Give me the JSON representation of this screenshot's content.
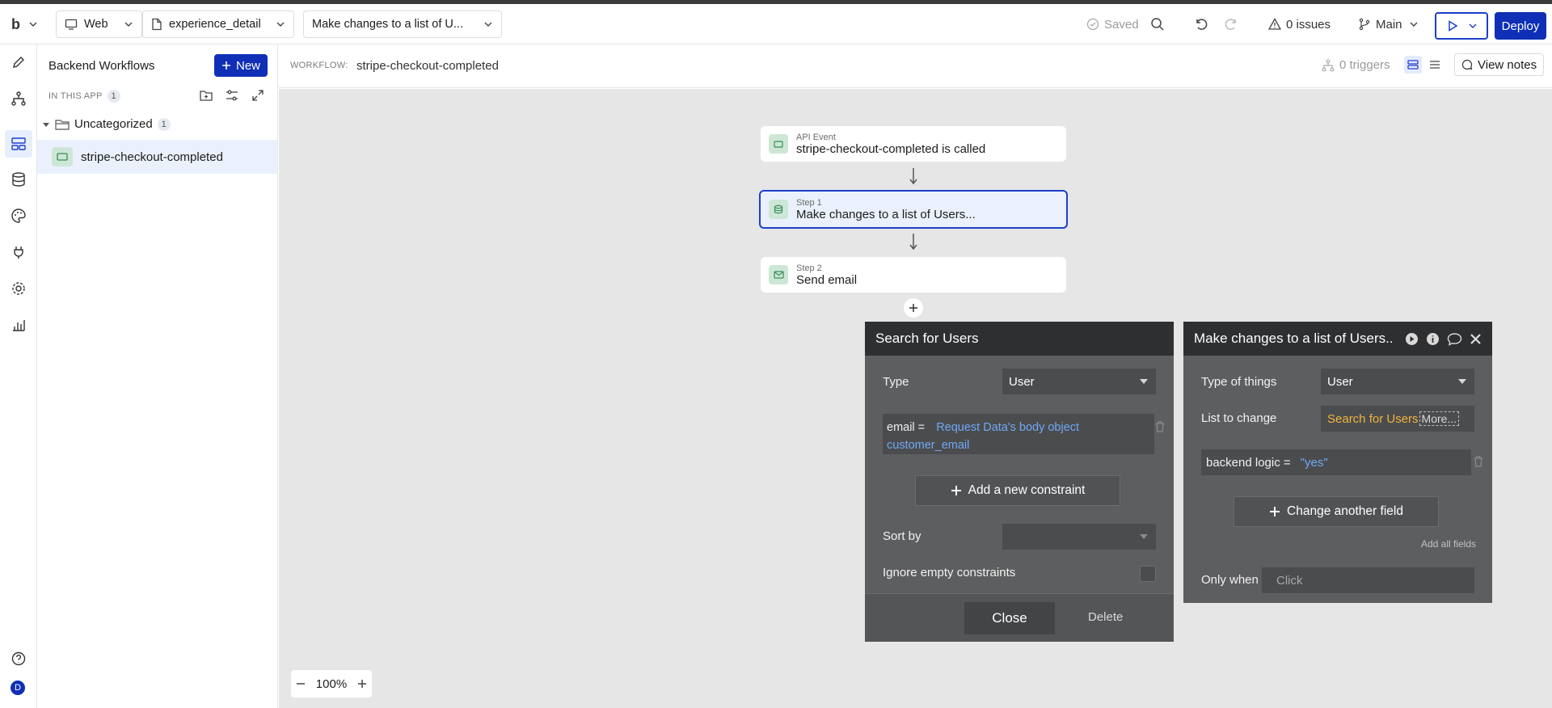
{
  "topbar": {
    "logo": "b",
    "platform": "Web",
    "page": "experience_detail",
    "workflow_select": "Make changes to a list of U...",
    "saved": "Saved",
    "issues": "0 issues",
    "branch": "Main",
    "deploy": "Deploy"
  },
  "sidebar": {
    "title": "Backend Workflows",
    "new_button": "New",
    "in_this_app": "IN THIS APP",
    "in_this_app_count": "1",
    "folder": "Uncategorized",
    "folder_count": "1",
    "workflow_item": "stripe-checkout-completed"
  },
  "rail": {
    "avatar_initial": "D"
  },
  "workflow_bar": {
    "label": "WORKFLOW:",
    "name": "stripe-checkout-completed",
    "triggers": "0 triggers",
    "view_notes": "View notes"
  },
  "canvas": {
    "event": {
      "sub": "API Event",
      "main": "stripe-checkout-completed is called"
    },
    "step1": {
      "sub": "Step 1",
      "main": "Make changes to a list of Users..."
    },
    "step2": {
      "sub": "Step 2",
      "main": "Send email"
    },
    "zoom": "100%"
  },
  "search_panel": {
    "title": "Search for Users",
    "type_label": "Type",
    "type_value": "User",
    "constraint_key": "email =",
    "constraint_value_1": "Request Data's body object",
    "constraint_value_2": "customer_email",
    "add_constraint": "Add a new constraint",
    "sort_by": "Sort by",
    "ignore_empty": "Ignore empty constraints",
    "close": "Close",
    "delete": "Delete"
  },
  "change_panel": {
    "title": "Make changes to a list of Users..",
    "type_of_things_label": "Type of things",
    "type_of_things_value": "User",
    "list_to_change_label": "List to change",
    "list_to_change_value": "Search for Users",
    "list_more": "More...",
    "field_key": "backend logic =",
    "field_value": "\"yes\"",
    "change_another": "Change another field",
    "add_all_fields": "Add all fields",
    "only_when_label": "Only when",
    "only_when_placeholder": "Click"
  },
  "colors": {
    "primary": "#0e2fb6",
    "panel_bg": "#5d5e60",
    "panel_head": "#2d2f31",
    "canvas_bg": "#e6e6e6",
    "dynamic_blue": "#6fa8f5",
    "dynamic_orange": "#f0b43e"
  }
}
